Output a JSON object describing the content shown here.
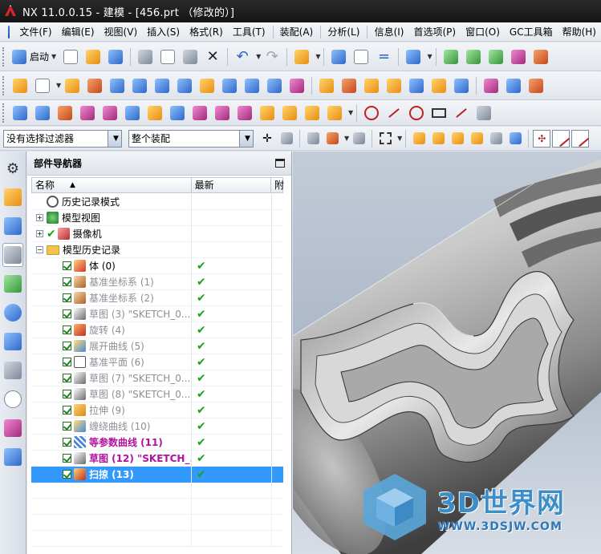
{
  "window": {
    "title": "NX 11.0.0.15 - 建模 - [456.prt （修改的）]"
  },
  "menu": {
    "items": [
      "文件(F)",
      "编辑(E)",
      "视图(V)",
      "插入(S)",
      "格式(R)",
      "工具(T)",
      "装配(A)",
      "分析(L)",
      "信息(I)",
      "首选项(P)",
      "窗口(O)",
      "GC工具箱",
      "帮助(H)"
    ]
  },
  "toolbar": {
    "start_label": "启动"
  },
  "selection_bar": {
    "filter_value": "没有选择过滤器",
    "scope_value": "整个装配"
  },
  "navigator": {
    "title": "部件导航器",
    "columns": {
      "name": "名称",
      "latest": "最新",
      "extra": "附"
    },
    "nodes": [
      {
        "label": "历史记录模式",
        "level": 0,
        "expander": "",
        "style": "normal",
        "latest": ""
      },
      {
        "label": "模型视图",
        "level": 0,
        "expander": "+",
        "style": "normal",
        "latest": ""
      },
      {
        "label": "摄像机",
        "level": 0,
        "expander": "+",
        "style": "normal",
        "latest": ""
      },
      {
        "label": "模型历史记录",
        "level": 0,
        "expander": "−",
        "style": "normal",
        "latest": ""
      },
      {
        "label": "体 (0)",
        "level": 1,
        "style": "normal",
        "latest": "✔"
      },
      {
        "label": "基准坐标系 (1)",
        "level": 1,
        "style": "dim",
        "latest": "✔"
      },
      {
        "label": "基准坐标系 (2)",
        "level": 1,
        "style": "dim",
        "latest": "✔"
      },
      {
        "label": "草图 (3) \"SKETCH_0...",
        "level": 1,
        "style": "dim",
        "latest": "✔"
      },
      {
        "label": "旋转 (4)",
        "level": 1,
        "style": "dim",
        "latest": "✔"
      },
      {
        "label": "展开曲线 (5)",
        "level": 1,
        "style": "dim",
        "latest": "✔"
      },
      {
        "label": "基准平面 (6)",
        "level": 1,
        "style": "dim",
        "latest": "✔"
      },
      {
        "label": "草图 (7) \"SKETCH_0...",
        "level": 1,
        "style": "dim",
        "latest": "✔"
      },
      {
        "label": "草图 (8) \"SKETCH_0...",
        "level": 1,
        "style": "dim",
        "latest": "✔"
      },
      {
        "label": "拉伸 (9)",
        "level": 1,
        "style": "dim",
        "latest": "✔"
      },
      {
        "label": "缠绕曲线 (10)",
        "level": 1,
        "style": "dim",
        "latest": "✔"
      },
      {
        "label": "等参数曲线 (11)",
        "level": 1,
        "style": "magenta",
        "latest": "✔"
      },
      {
        "label": "草图 (12) \"SKETCH_...",
        "level": 1,
        "style": "magenta",
        "latest": "✔"
      },
      {
        "label": "扫掠 (13)",
        "level": 1,
        "style": "selected",
        "latest": "✔"
      }
    ]
  },
  "watermark": {
    "title": "3D世界网",
    "url": "WWW.3DSJW.COM"
  },
  "colors": {
    "selection": "#3399ff",
    "dim_text": "#8b8f96",
    "highlight_text": "#b0129e",
    "check": "#18a518"
  }
}
